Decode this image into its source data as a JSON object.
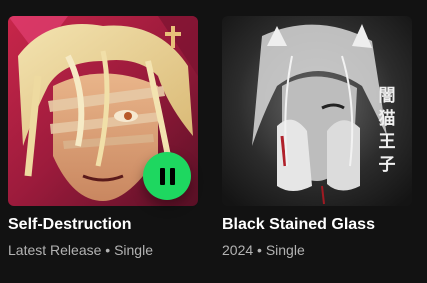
{
  "cards": [
    {
      "title": "Self-Destruction",
      "subtitle": "Latest Release • Single",
      "is_playing": true,
      "accent_color": "#1ed760"
    },
    {
      "title": "Black Stained Glass",
      "subtitle": "2024 • Single",
      "is_playing": false
    }
  ],
  "colors": {
    "background": "#121212",
    "title_text": "#ffffff",
    "subtitle_text": "#b3b3b3",
    "play_button": "#1ed760"
  },
  "icons": {
    "pause": "pause-icon"
  },
  "artwork_2_text": "闇猫王子"
}
